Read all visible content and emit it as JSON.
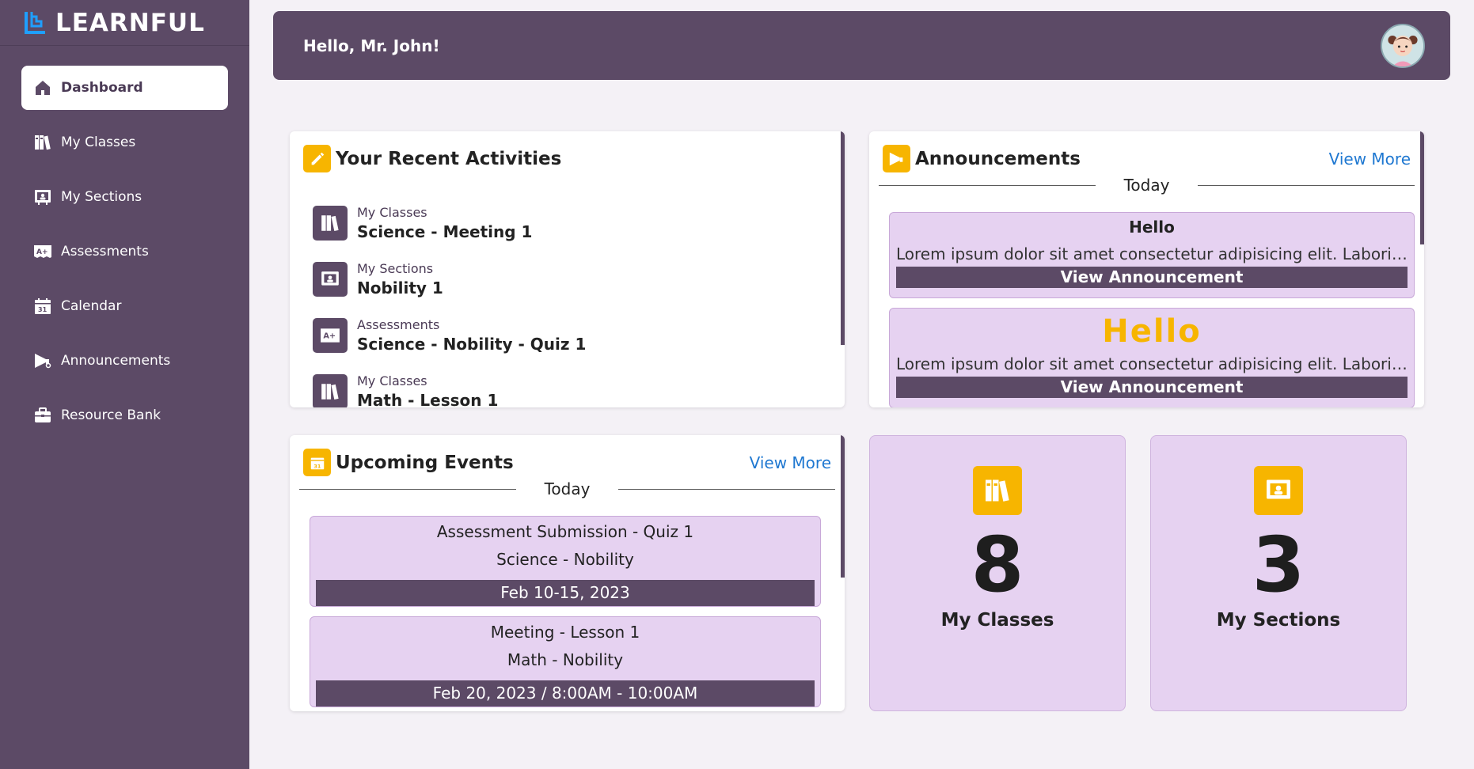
{
  "brand": {
    "name": "LEARNFUL",
    "accent": "#1f9fff"
  },
  "colors": {
    "primary": "#5c4a66",
    "accent": "#f7b500",
    "card_tint": "#e6d2f1",
    "link": "#1f78d1"
  },
  "sidebar": {
    "items": [
      {
        "label": "Dashboard",
        "icon": "home-icon",
        "active": true
      },
      {
        "label": "My Classes",
        "icon": "books-icon"
      },
      {
        "label": "My Sections",
        "icon": "section-board-icon"
      },
      {
        "label": "Assessments",
        "icon": "grade-icon"
      },
      {
        "label": "Calendar",
        "icon": "calendar-icon"
      },
      {
        "label": "Announcements",
        "icon": "megaphone-icon"
      },
      {
        "label": "Resource Bank",
        "icon": "briefcase-icon"
      }
    ]
  },
  "header": {
    "greeting": "Hello, Mr. John!"
  },
  "activities": {
    "title": "Your Recent Activities",
    "items": [
      {
        "category": "My Classes",
        "title": "Science - Meeting 1",
        "icon": "books-icon"
      },
      {
        "category": "My Sections",
        "title": "Nobility 1",
        "icon": "section-board-icon"
      },
      {
        "category": "Assessments",
        "title": "Science - Nobility - Quiz 1",
        "icon": "grade-icon"
      },
      {
        "category": "My Classes",
        "title": "Math - Lesson 1",
        "icon": "books-icon"
      }
    ]
  },
  "announcements": {
    "title": "Announcements",
    "view_more": "View More",
    "day_label": "Today",
    "items": [
      {
        "title": "Hello",
        "body": "Lorem ipsum dolor sit amet consectetur adipisicing elit. Laboriosam, voluptates.",
        "button": "View Announcement"
      },
      {
        "title": "Hello",
        "body": "Lorem ipsum dolor sit amet consectetur adipisicing elit. Laboriosam, voluptates.",
        "button": "View Announcement"
      }
    ]
  },
  "events": {
    "title": "Upcoming Events",
    "view_more": "View More",
    "day_label": "Today",
    "items": [
      {
        "title": "Assessment Submission - Quiz 1",
        "sub": "Science - Nobility",
        "date": "Feb 10-15, 2023"
      },
      {
        "title": "Meeting - Lesson 1",
        "sub": "Math - Nobility",
        "date": "Feb 20, 2023 / 8:00AM - 10:00AM"
      }
    ]
  },
  "stats": {
    "classes": {
      "count": "8",
      "label": "My Classes"
    },
    "sections": {
      "count": "3",
      "label": "My Sections"
    }
  }
}
